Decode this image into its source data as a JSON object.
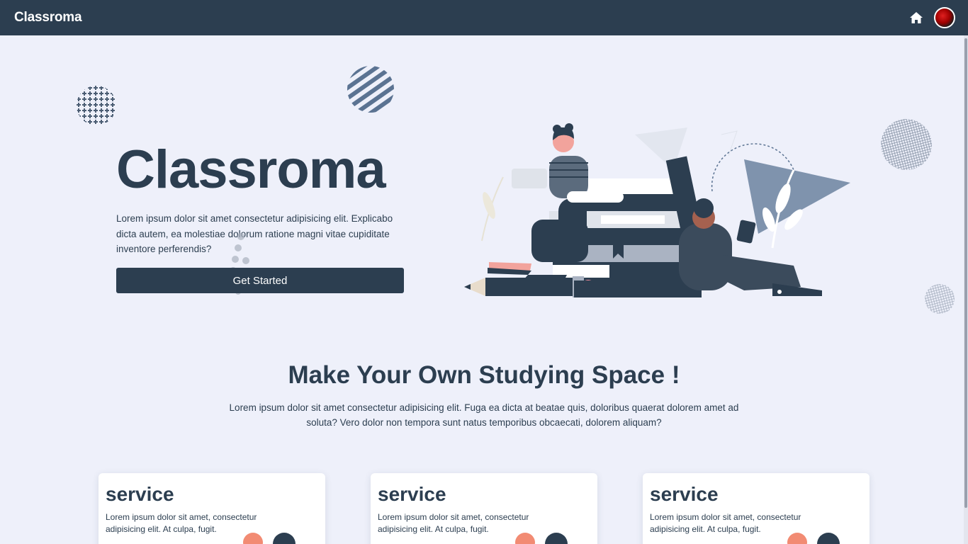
{
  "navbar": {
    "brand": "Classroma",
    "home_icon": "home-icon",
    "avatar": "user-avatar"
  },
  "hero": {
    "title": "Classroma",
    "text": "Lorem ipsum dolor sit amet consectetur adipisicing elit. Explicabo dicta autem, ea molestiae dolorum ratione magni vitae cupiditate inventore perferendis?",
    "button_label": "Get Started"
  },
  "section": {
    "title": "Make Your Own Studying Space !",
    "text": "Lorem ipsum dolor sit amet consectetur adipisicing elit. Fuga ea dicta at beatae quis, doloribus quaerat dolorem amet ad soluta? Vero dolor non tempora sunt natus temporibus obcaecati, dolorem aliquam?"
  },
  "cards": [
    {
      "title": "service",
      "text": "Lorem ipsum dolor sit amet, consectetur adipisicing elit. At culpa, fugit."
    },
    {
      "title": "service",
      "text": "Lorem ipsum dolor sit amet, consectetur adipisicing elit. At culpa, fugit."
    },
    {
      "title": "service",
      "text": "Lorem ipsum dolor sit amet, consectetur adipisicing elit. At culpa, fugit."
    }
  ],
  "colors": {
    "primary": "#2c3e50",
    "background": "#eef0fa",
    "accent_blue": "#5b7392",
    "accent_pink": "#f28b9b"
  }
}
